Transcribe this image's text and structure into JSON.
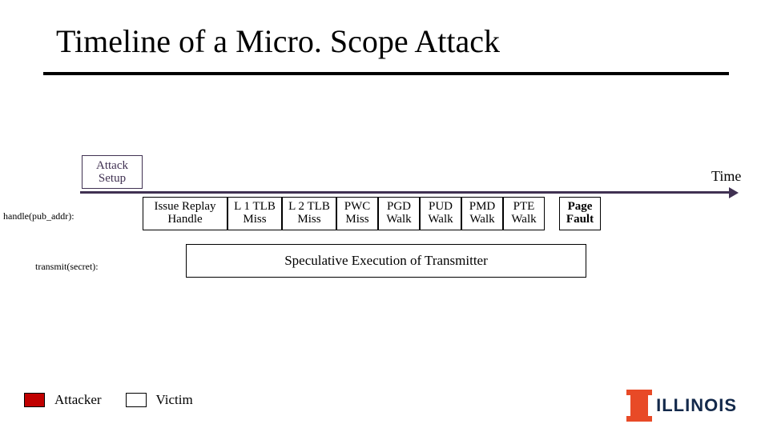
{
  "title": "Timeline of a Micro. Scope Attack",
  "attack_setup": "Attack Setup",
  "time_label": "Time",
  "row_labels": {
    "handle": "handle(pub_addr):",
    "transmit": "transmit(secret):"
  },
  "cells": {
    "issue": "Issue Replay Handle",
    "l1": "L 1 TLB Miss",
    "l2": "L 2 TLB Miss",
    "pwc": "PWC Miss",
    "pgd": "PGD Walk",
    "pud": "PUD Walk",
    "pmd": "PMD Walk",
    "pte": "PTE Walk",
    "fault": "Page Fault"
  },
  "spec_exec": "Speculative Execution of Transmitter",
  "legend": {
    "attacker": "Attacker",
    "victim": "Victim"
  },
  "logo_text": "ILLINOIS"
}
